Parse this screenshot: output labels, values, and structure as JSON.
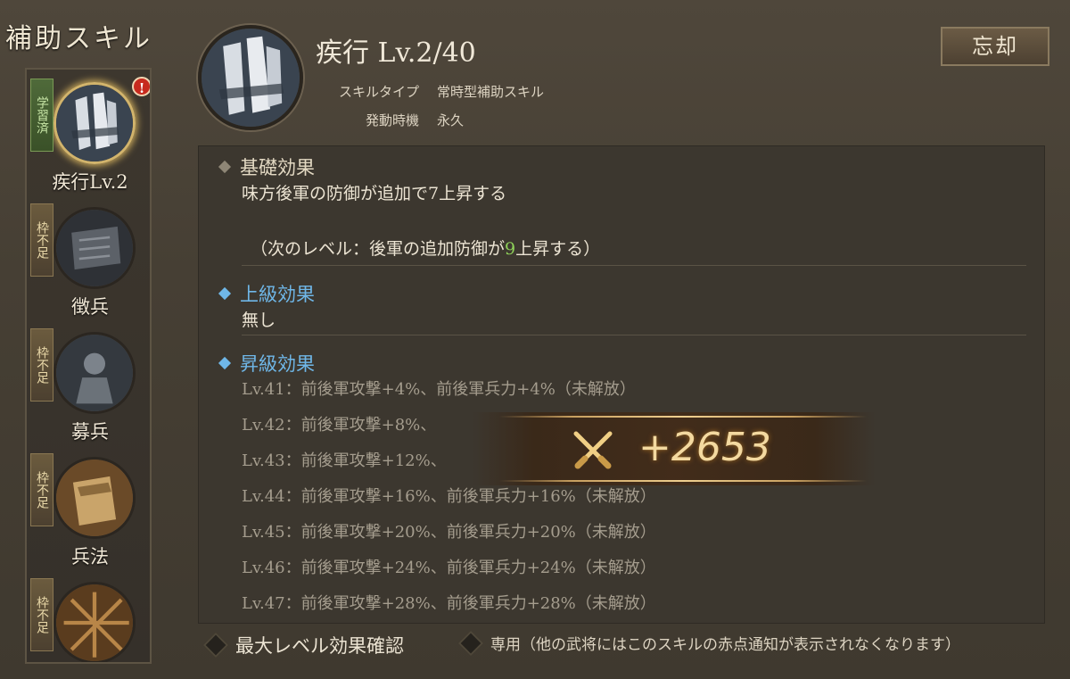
{
  "sidebar": {
    "title": "補助スキル",
    "items": [
      {
        "label": "疾行Lv.2",
        "status": "学習済",
        "alert": "!"
      },
      {
        "label": "徴兵",
        "status": "枠不足"
      },
      {
        "label": "募兵",
        "status": "枠不足"
      },
      {
        "label": "兵法",
        "status": "枠不足"
      },
      {
        "label": "",
        "status": "枠不足"
      }
    ]
  },
  "header": {
    "title": "疾行 Lv.2/40",
    "skill_type_label": "スキルタイプ",
    "skill_type_value": "常時型補助スキル",
    "trigger_label": "発動時機",
    "trigger_value": "永久",
    "forget_button": "忘却"
  },
  "panel": {
    "basic": {
      "heading": "基礎効果",
      "text": "味方後軍の防御が追加で7上昇する",
      "next_prefix": "（次のレベル：後軍の追加防御が",
      "next_value": "9",
      "next_suffix": "上昇する）"
    },
    "advanced": {
      "heading": "上級効果",
      "text": "無し"
    },
    "upgrade": {
      "heading": "昇級効果",
      "levels": [
        "Lv.41：前後軍攻撃+4%、前後軍兵力+4%（未解放）",
        "Lv.42：前後軍攻撃+8%、",
        "Lv.43：前後軍攻撃+12%、",
        "Lv.44：前後軍攻撃+16%、前後軍兵力+16%（未解放）",
        "Lv.45：前後軍攻撃+20%、前後軍兵力+20%（未解放）",
        "Lv.46：前後軍攻撃+24%、前後軍兵力+24%（未解放）",
        "Lv.47：前後軍攻撃+28%、前後軍兵力+28%（未解放）"
      ]
    }
  },
  "bottom": {
    "max_level_check": "最大レベル効果確認",
    "exclusive_note": "専用（他の武将にはこのスキルの赤点通知が表示されなくなります）"
  },
  "popup": {
    "power": "+2653",
    "icon": "crossed-swords-icon"
  },
  "colors": {
    "accent_blue": "#6fb7e8",
    "accent_green": "#8fd25a",
    "gold": "#d2b46c"
  }
}
